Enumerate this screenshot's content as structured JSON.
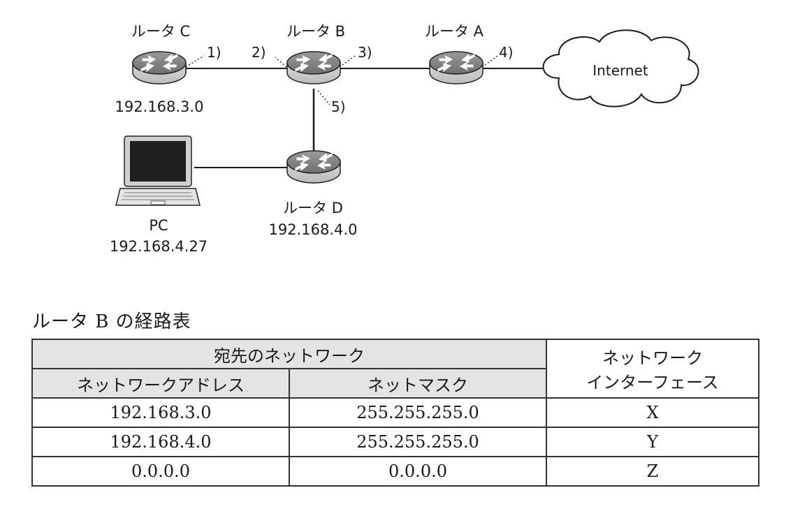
{
  "diagram": {
    "routers": {
      "c": {
        "label": "ルータ C",
        "network": "192.168.3.0"
      },
      "b": {
        "label": "ルータ B"
      },
      "a": {
        "label": "ルータ A"
      },
      "d": {
        "label": "ルータ D",
        "network": "192.168.4.0"
      }
    },
    "interfaces": {
      "i1": "1)",
      "i2": "2)",
      "i3": "3)",
      "i4": "4)",
      "i5": "5)"
    },
    "cloud_label": "Internet",
    "pc": {
      "label": "PC",
      "ip": "192.168.4.27"
    }
  },
  "routing_table": {
    "caption": "ルータ B の経路表",
    "header_group": "宛先のネットワーク",
    "header_iface_line1": "ネットワーク",
    "header_iface_line2": "インターフェース",
    "header_address": "ネットワークアドレス",
    "header_mask": "ネットマスク",
    "rows": [
      {
        "address": "192.168.3.0",
        "mask": "255.255.255.0",
        "iface": "X"
      },
      {
        "address": "192.168.4.0",
        "mask": "255.255.255.0",
        "iface": "Y"
      },
      {
        "address": "0.0.0.0",
        "mask": "0.0.0.0",
        "iface": "Z"
      }
    ]
  }
}
